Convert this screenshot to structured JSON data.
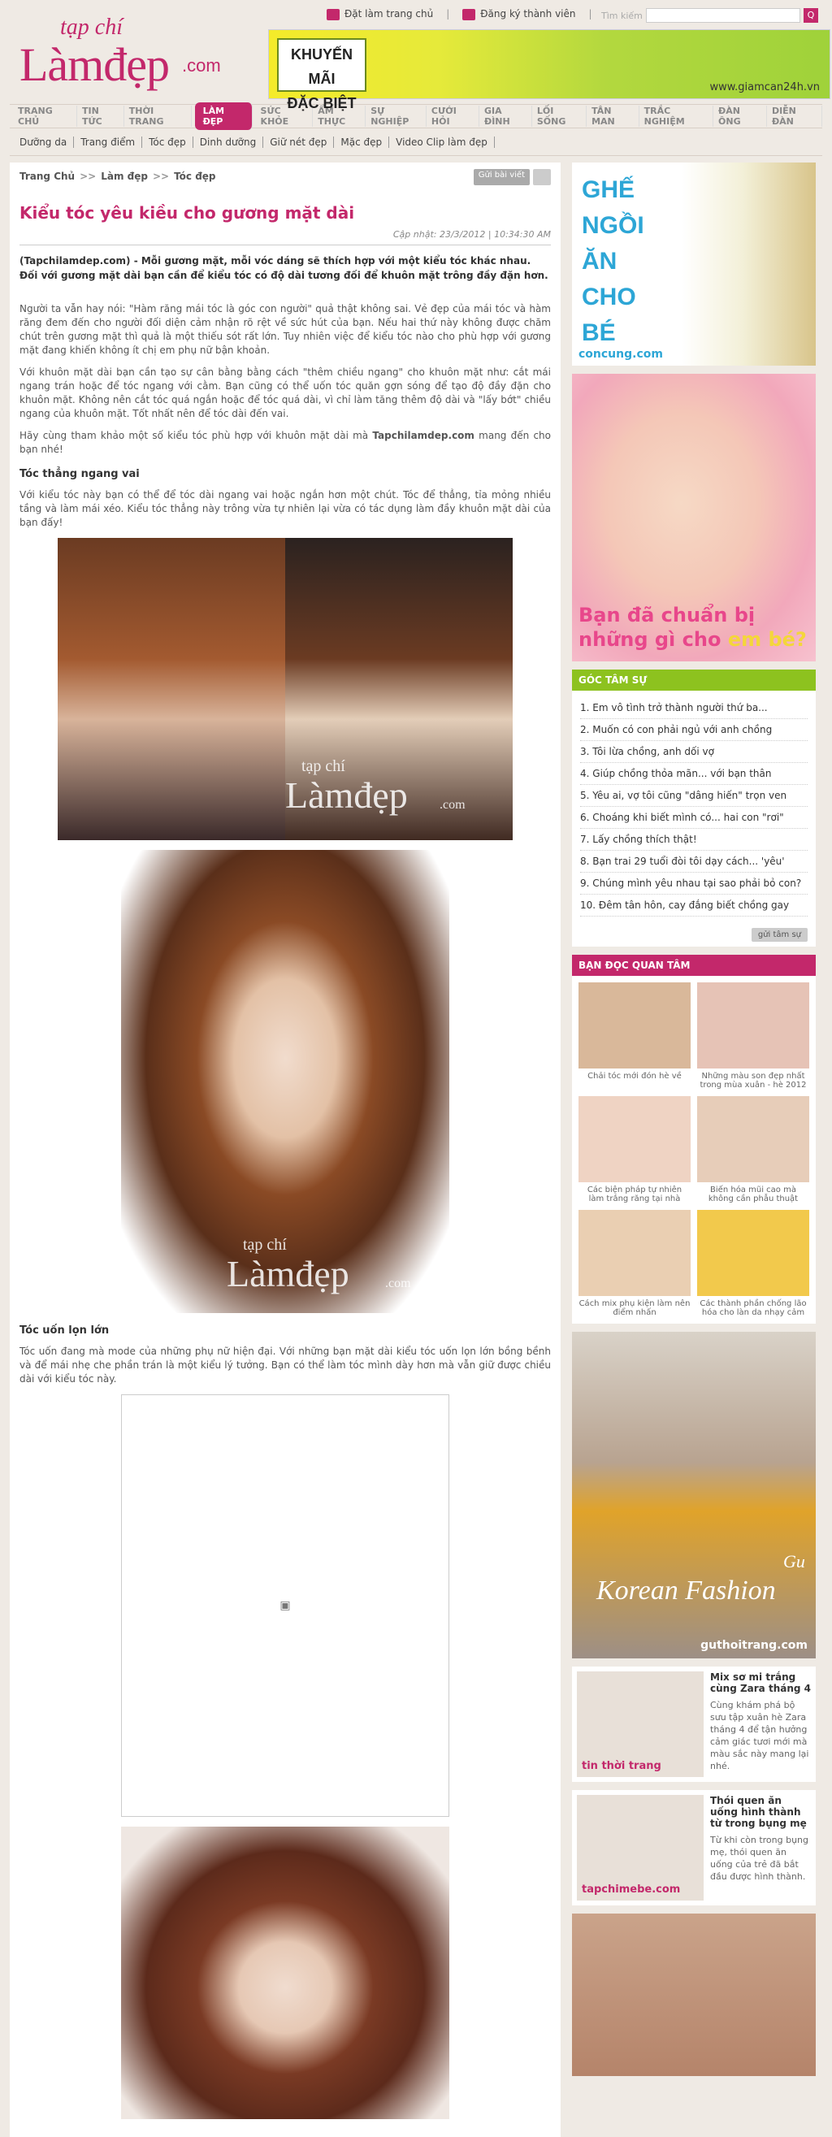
{
  "header": {
    "logo": {
      "small": "tạp chí",
      "big": "Làmđẹp",
      "com": ".com"
    },
    "top_links": [
      "Đặt làm trang chủ",
      "Đăng ký thành viên"
    ],
    "search": {
      "label": "Tìm kiếm",
      "placeholder": "",
      "button": "Q"
    },
    "banner": {
      "promo_line1": "KHUYẾN MÃI",
      "promo_line2": "ĐẶC BIỆT",
      "site": "www.giamcan24h.vn"
    }
  },
  "nav": {
    "items": [
      "TRANG CHỦ",
      "TIN TỨC",
      "THỜI TRANG",
      "LÀM ĐẸP",
      "SỨC KHỎE",
      "ẨM THỰC",
      "SỰ NGHIỆP",
      "CƯỚI HỎI",
      "GIA ĐÌNH",
      "LỐI SỐNG",
      "TÂN MAN",
      "TRẮC NGHIỆM",
      "ĐÀN ÔNG",
      "DIỄN ĐÀN"
    ],
    "active_index": 3
  },
  "subnav": [
    "Dưỡng da",
    "Trang điểm",
    "Tóc đẹp",
    "Dinh dưỡng",
    "Giữ nét đẹp",
    "Mặc đẹp",
    "Video Clip làm đẹp"
  ],
  "breadcrumb": [
    "Trang Chủ",
    "Làm đẹp",
    "Tóc đẹp"
  ],
  "breadcrumb_sep": ">>",
  "tools": {
    "send": "Gửi bài viết"
  },
  "article": {
    "title": "Kiểu tóc yêu kiều cho gương mặt dài",
    "updated": "Cập nhật: 23/3/2012 | 10:34:30 AM",
    "lead": "(Tapchilamdep.com) - Mỗi gương mặt, mỗi vóc dáng sẽ thích hợp với một kiểu tóc khác nhau. Đối với gương mặt dài bạn cần để kiểu tóc có độ dài tương đối để khuôn mặt trông đầy đặn hơn.",
    "p1": "Người ta vẫn hay nói: \"Hàm răng mái tóc là góc con người\" quả thật không sai. Vẻ đẹp của mái tóc và hàm răng đem đến cho người đối diện cảm nhận rõ rệt về sức hút của bạn. Nếu hai thứ này không được chăm chút trên gương mặt thì quả là một thiếu sót rất lớn. Tuy nhiên việc để kiểu tóc nào cho phù hợp với gương mặt đang khiến không ít chị em phụ nữ bận khoản.",
    "p2": "Với khuôn mặt dài bạn cần tạo sự cân bằng bằng cách \"thêm chiều ngang\" cho khuôn mặt như: cắt mái ngang trán hoặc để tóc ngang với cằm. Bạn cũng có thể uốn tóc quăn gợn sóng để tạo độ đầy đặn cho khuôn mặt. Không nên cắt tóc quá ngắn hoặc để tóc quá dài, vì chỉ làm tăng thêm độ dài và \"lấy bớt\" chiều ngang của khuôn mặt. Tốt nhất nên để tóc dài đến vai.",
    "p3_pre": "Hãy cùng tham khảo một số kiểu tóc phù hợp với khuôn mặt dài mà ",
    "p3_bold": "Tapchilamdep.com",
    "p3_post": " mang đến cho bạn nhé!",
    "h_straight": "Tóc thẳng ngang vai",
    "p4": "Với kiểu tóc này bạn có thể để tóc dài ngang vai hoặc ngắn hơn một chút. Tóc để thẳng, tỉa mỏng nhiều tầng và làm mái xéo. Kiểu tóc thẳng này trông vừa tự nhiên lại vừa có tác dụng làm đầy khuôn mặt dài của bạn đấy!",
    "h_curl": "Tóc uốn lọn lớn",
    "p5": "Tóc uốn đang mà mode của những phụ nữ hiện đại. Với những bạn mặt dài kiểu tóc uốn lọn lớn bồng bềnh và để mái nhẹ che phần trán là một kiểu lý tưởng. Bạn có thể làm tóc mình dày hơn mà vẫn giữ được chiều dài với kiểu tóc này.",
    "watermark_small": "tạp chí",
    "watermark_big": "Làmđẹp",
    "watermark_com": ".com"
  },
  "sidebar": {
    "ad1": {
      "text": "GHẾ NGỒI ĂN CHO BÉ",
      "site": "concung.com"
    },
    "ad2": {
      "text1": "Bạn đã chuẩn bị",
      "text2": "những gì cho",
      "text3": "em bé?"
    },
    "confide": {
      "title": "GÓC TÂM SỰ",
      "items": [
        "1. Em vô tình trở thành người thứ ba...",
        "2. Muốn có con phải ngủ với anh chồng",
        "3. Tôi lừa chồng, anh dối vợ",
        "4. Giúp chồng thỏa mãn... với bạn thân",
        "5. Yêu ai, vợ tôi cũng \"dâng hiến\" trọn ven",
        "6. Choáng khi biết mình có... hai con \"rơi\"",
        "7. Lấy chồng thích thật!",
        "8. Bạn trai 29 tuổi đòi tôi dạy cách... 'yêu'",
        "9. Chúng mình yêu nhau tại sao phải bỏ con?",
        "10. Đêm tân hôn, cay đắng biết chồng gay"
      ],
      "send": "gửi tâm sự"
    },
    "readers": {
      "title": "BẠN ĐỌC QUAN TÂM",
      "items": [
        "Chải tóc mới đón hè về",
        "Những màu son đẹp nhất trong mùa xuân - hè 2012",
        "Các biện pháp tự nhiên làm trắng răng tại nhà",
        "Biến hóa mũi cao mà không cần phẫu thuật",
        "Cách mix phụ kiện làm nên điểm nhấn",
        "Các thành phần chống lão hóa cho làn da nhạy cảm"
      ]
    },
    "ad3": {
      "text1": "Korean Fashion",
      "text2": "Gu",
      "site": "guthoitrang.com"
    },
    "stories": [
      {
        "title": "Mix sơ mi trắng cùng Zara tháng 4",
        "desc": "Cùng khám phá bộ sưu tập xuân hè Zara tháng 4 để tận hưởng cảm giác tươi mới mà màu sắc này mang lại nhé.",
        "brand": "tin thời trang"
      },
      {
        "title": "Thói quen ăn uống hình thành từ trong bụng mẹ",
        "desc": "Từ khi còn trong bụng mẹ, thói quen ăn uống của trẻ đã bắt đầu được hình thành.",
        "brand": "tapchimebe.com"
      }
    ]
  }
}
